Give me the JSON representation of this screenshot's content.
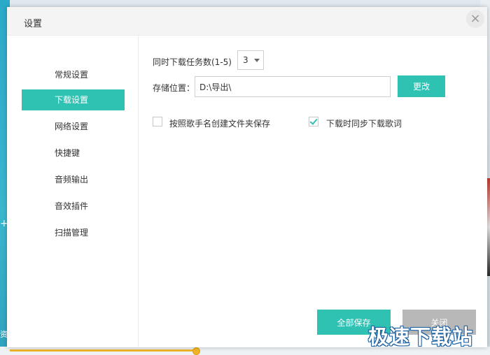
{
  "background": {
    "left_glyph": "+",
    "left_glyph2": "资"
  },
  "dialog": {
    "title": "设置",
    "close_symbol": "×"
  },
  "sidebar": {
    "items": [
      {
        "label": "常规设置",
        "active": false
      },
      {
        "label": "下载设置",
        "active": true
      },
      {
        "label": "网络设置",
        "active": false
      },
      {
        "label": "快捷键",
        "active": false
      },
      {
        "label": "音频输出",
        "active": false
      },
      {
        "label": "音效插件",
        "active": false
      },
      {
        "label": "扫描管理",
        "active": false
      }
    ]
  },
  "download": {
    "concurrent_label": "同时下载任务数(1-5)",
    "concurrent_value": "3",
    "storage_label": "存储位置：",
    "storage_path": "D:\\导出\\",
    "change_button": "更改",
    "option_folder_label": "按照歌手名创建文件夹保存",
    "option_folder_checked": false,
    "option_lyrics_label": "下载时同步下载歌词",
    "option_lyrics_checked": true
  },
  "footer": {
    "save_all": "全部保存",
    "close": "关闭"
  },
  "watermark": "极速下载站",
  "colors": {
    "accent": "#2fc1b2",
    "disabled": "#b8b8b8",
    "progress": "#f0b429"
  }
}
